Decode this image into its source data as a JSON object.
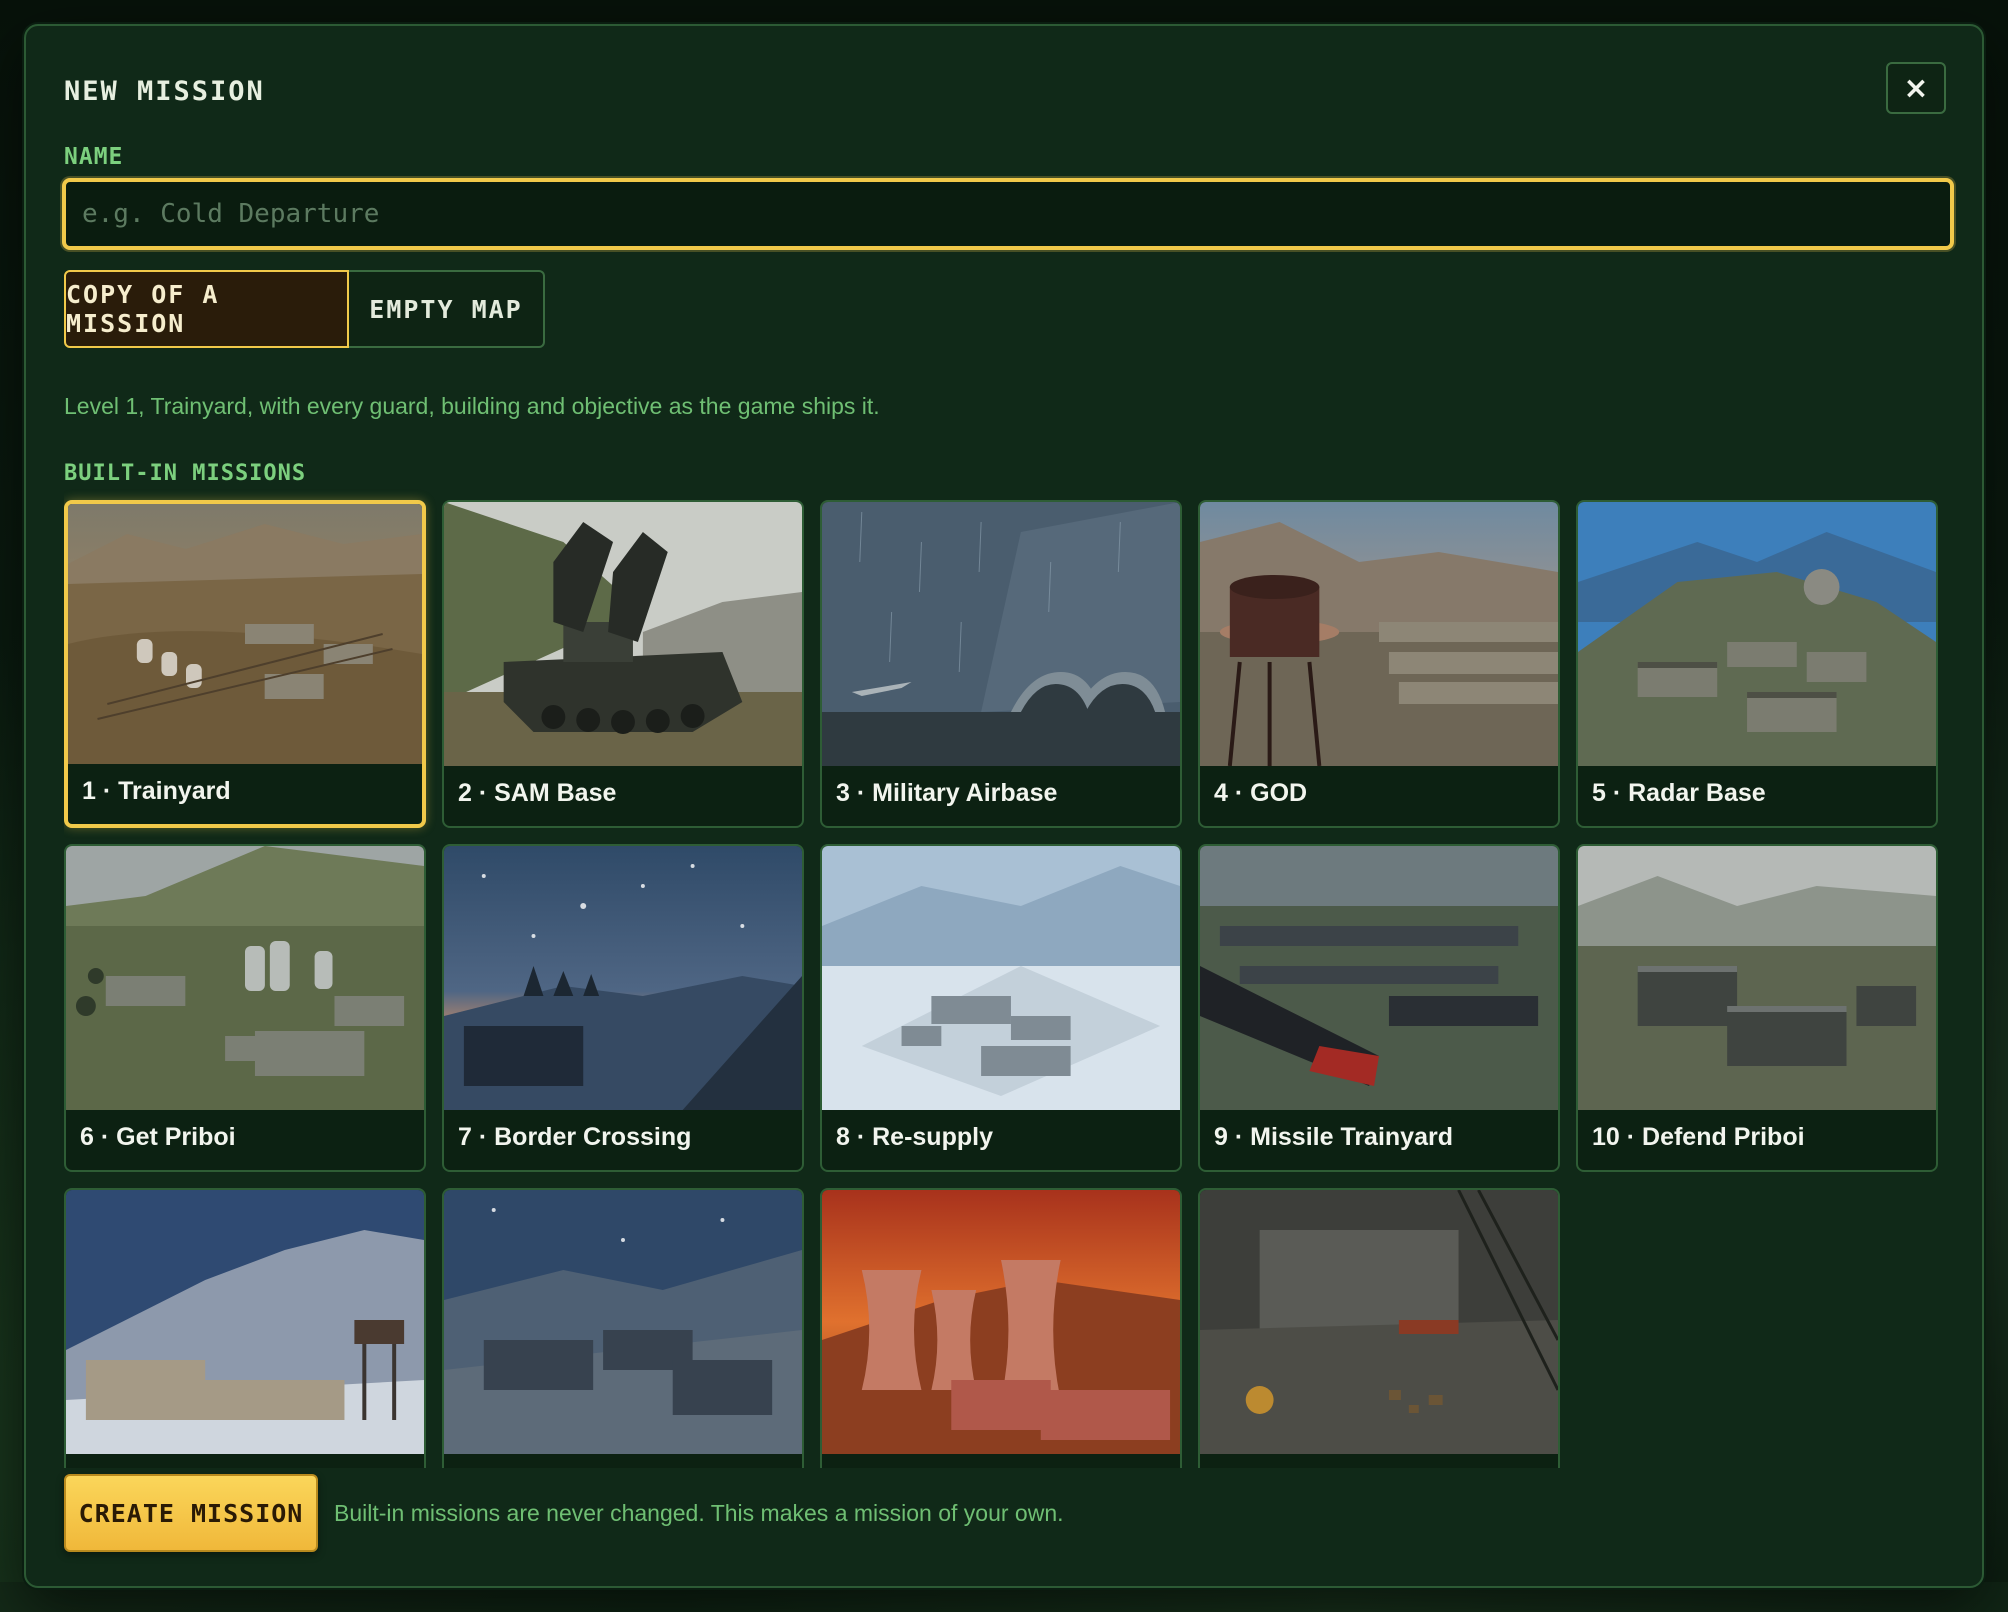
{
  "modal": {
    "title": "NEW MISSION",
    "close_label": "×"
  },
  "name_field": {
    "label": "NAME",
    "placeholder": "e.g. Cold Departure",
    "value": ""
  },
  "source_toggle": {
    "options": [
      "COPY OF A MISSION",
      "EMPTY MAP"
    ],
    "selected": "COPY OF A MISSION"
  },
  "description": "Level 1, Trainyard, with every guard, building and objective as the game ships it.",
  "builtin": {
    "section_label": "BUILT-IN MISSIONS",
    "selected_index": 0,
    "missions": [
      {
        "label": "1 · Trainyard"
      },
      {
        "label": "2 · SAM Base"
      },
      {
        "label": "3 · Military Airbase"
      },
      {
        "label": "4 · GOD"
      },
      {
        "label": "5 · Radar Base"
      },
      {
        "label": "6 · Get Priboi"
      },
      {
        "label": "7 · Border Crossing"
      },
      {
        "label": "8 · Re-supply"
      },
      {
        "label": "9 · Missile Trainyard"
      },
      {
        "label": "10 · Defend Priboi"
      },
      {
        "label": ""
      },
      {
        "label": ""
      },
      {
        "label": ""
      },
      {
        "label": ""
      }
    ]
  },
  "footer": {
    "create_label": "CREATE MISSION",
    "note": "Built-in missions are never changed. This makes a mission of your own."
  },
  "colors": {
    "accent": "#f1c94a",
    "panel": "#102918",
    "label_green": "#7cd07e"
  }
}
